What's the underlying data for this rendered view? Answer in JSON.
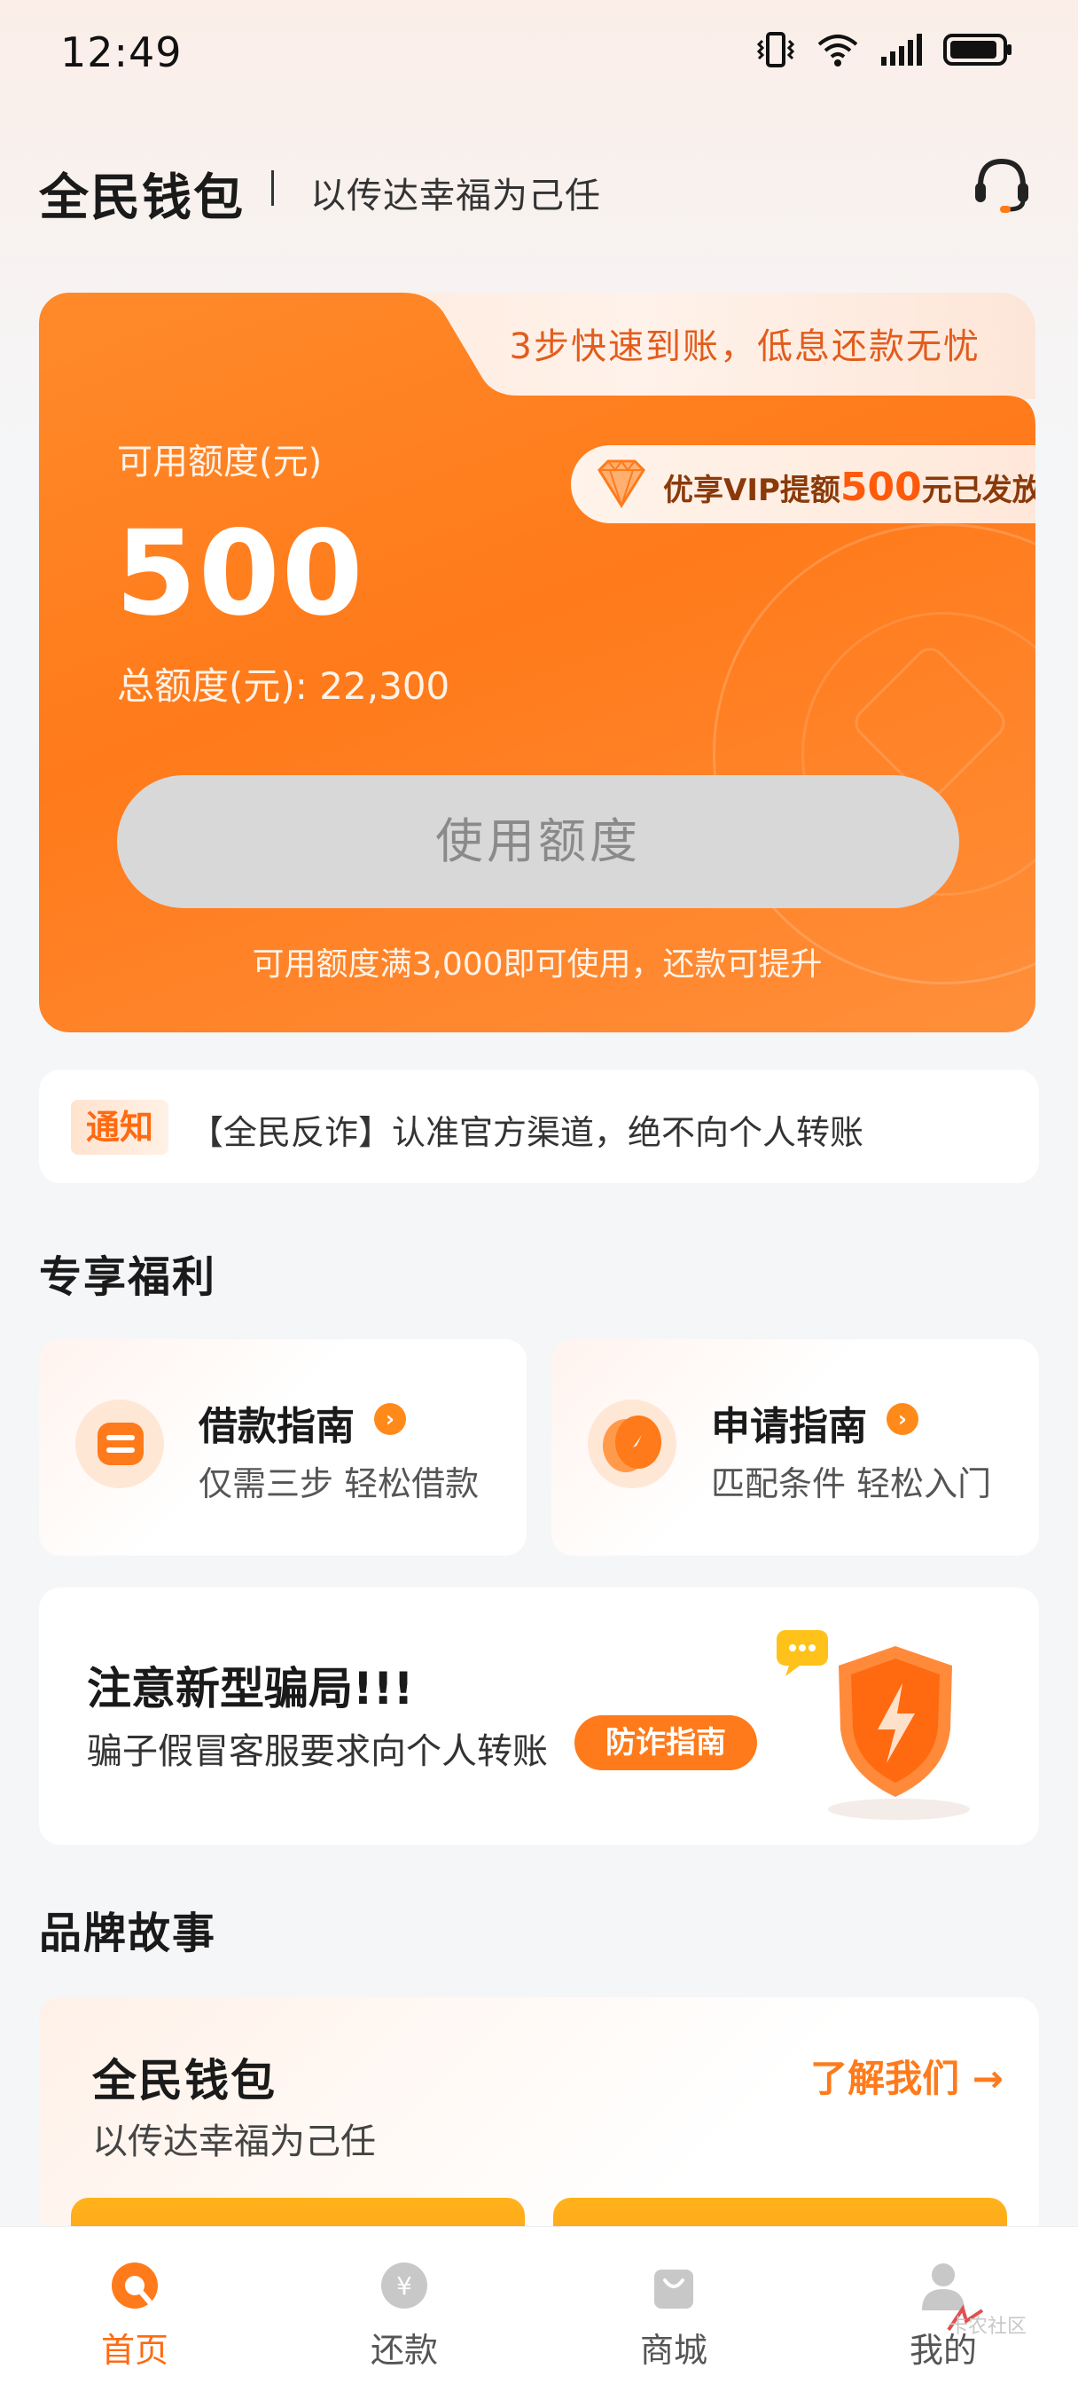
{
  "status_bar": {
    "time": "12:49"
  },
  "header": {
    "brand": "全民钱包",
    "slogan": "以传达幸福为己任"
  },
  "quota_card": {
    "tab_text": "3步快速到账，低息还款无忧",
    "available_label": "可用额度(元)",
    "available_value": "500",
    "total_label": "总额度(元): 22,300",
    "vip_prefix": "优享VIP提额",
    "vip_amount": "500",
    "vip_suffix": "元已发放",
    "use_button": "使用额度",
    "hint": "可用额度满3,000即可使用，还款可提升",
    "colors": {
      "accent": "#ff7a1a",
      "button_disabled": "#d8d8d8"
    }
  },
  "notice": {
    "tag": "通知",
    "text": "【全民反诈】认准官方渠道，绝不向个人转账"
  },
  "welfare": {
    "title": "专享福利",
    "cards": [
      {
        "title": "借款指南",
        "subtitle": "仅需三步 轻松借款",
        "icon": "loan-guide-icon"
      },
      {
        "title": "申请指南",
        "subtitle": "匹配条件 轻松入门",
        "icon": "apply-guide-icon"
      }
    ]
  },
  "fraud": {
    "title": "注意新型骗局!!!",
    "subtitle": "骗子假冒客服要求向个人转账",
    "button": "防诈指南",
    "icon": "shield-icon"
  },
  "brand_story": {
    "title": "品牌故事",
    "card_title": "全民钱包",
    "card_subtitle": "以传达幸福为己任",
    "link": "了解我们 →"
  },
  "tab_bar": {
    "items": [
      {
        "label": "首页",
        "icon": "home-icon",
        "active": true
      },
      {
        "label": "还款",
        "icon": "repay-icon",
        "active": false
      },
      {
        "label": "商城",
        "icon": "shop-icon",
        "active": false
      },
      {
        "label": "我的",
        "icon": "profile-icon",
        "active": false
      }
    ]
  },
  "watermark": {
    "text": "卡农社区"
  }
}
